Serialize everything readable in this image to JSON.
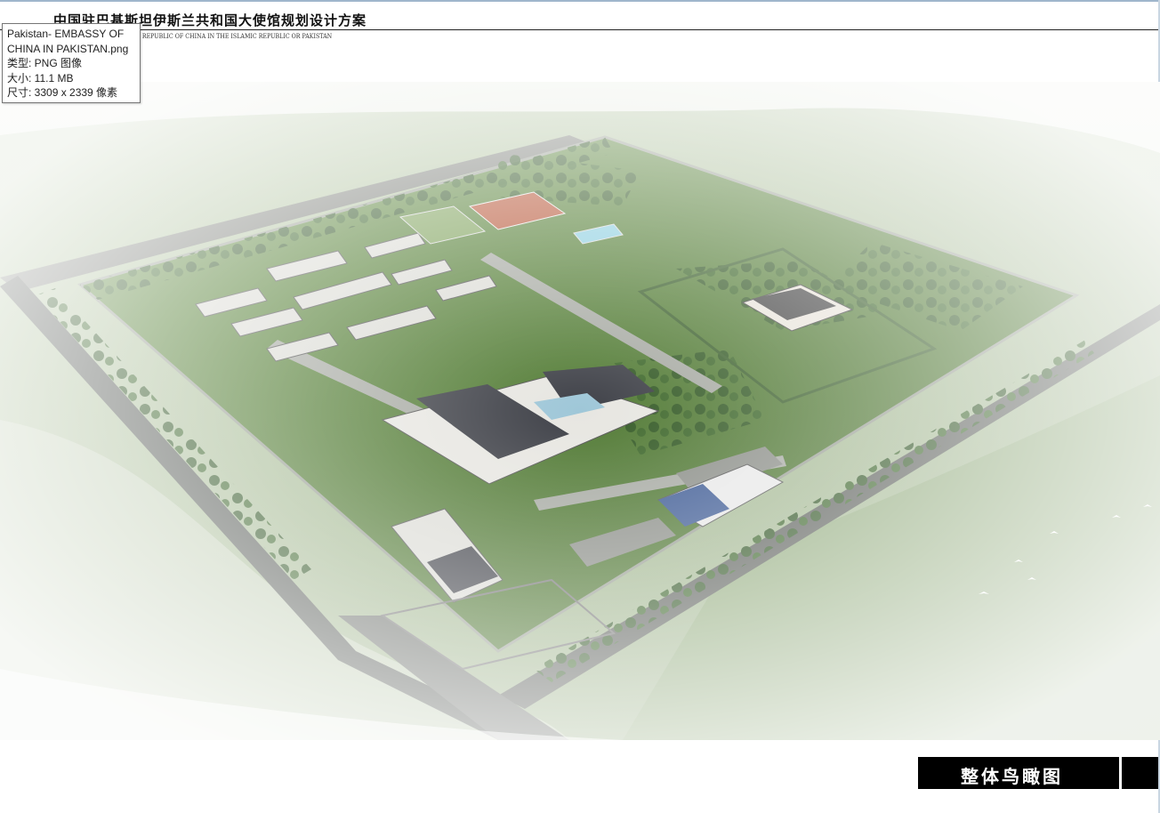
{
  "document": {
    "title_cn": "中国驻巴基斯坦伊斯兰共和国大使馆规划设计方案",
    "title_en": "EMBASSY OF THE PEOPLE' S REPUBLIC OF CHINA IN THE ISLAMIC REPUBLIC OR PAKISTAN"
  },
  "tooltip": {
    "name_line1": "Pakistan- EMBASSY OF",
    "name_line2": "CHINA IN PAKISTAN.png",
    "type": "类型: PNG 图像",
    "size": "大小: 11.1 MB",
    "dimensions": "尺寸: 3309 x 2339 像素"
  },
  "image": {
    "description_icon": "aerial-render-image"
  },
  "caption": {
    "label": "整体鸟瞰图"
  }
}
